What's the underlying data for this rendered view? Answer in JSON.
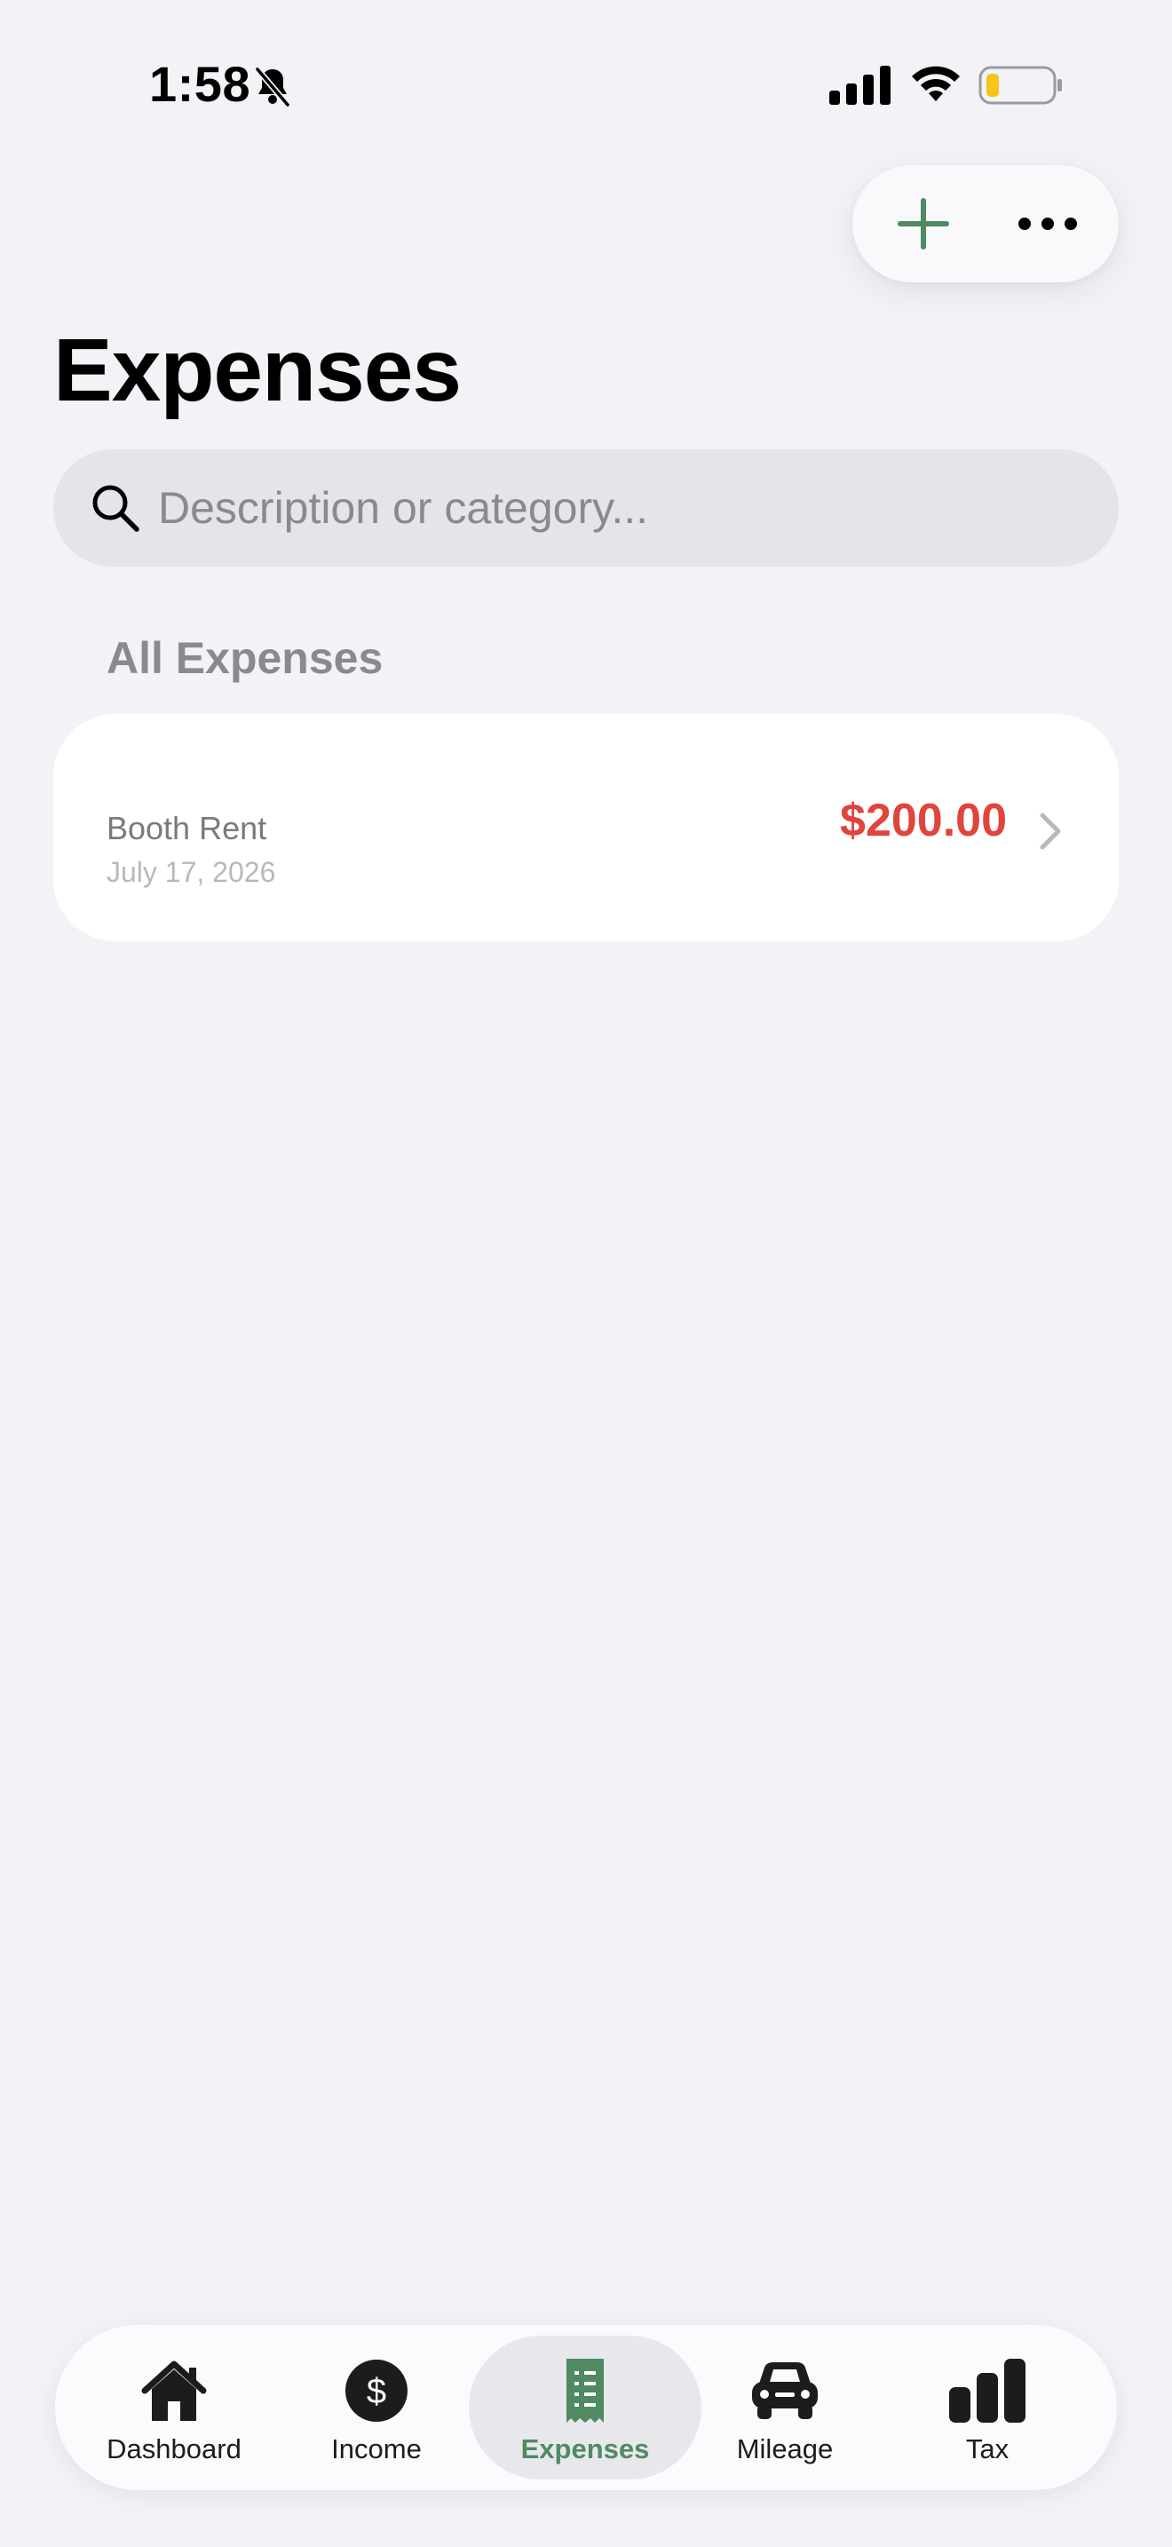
{
  "status_bar": {
    "time": "1:58"
  },
  "header": {
    "title": "Expenses"
  },
  "search": {
    "placeholder": "Description or category..."
  },
  "section": {
    "title": "All Expenses"
  },
  "expenses": [
    {
      "title": "Booth Rent",
      "date": "July 17, 2026",
      "amount": "$200.00"
    }
  ],
  "tabs": [
    {
      "label": "Dashboard",
      "icon": "house-icon"
    },
    {
      "label": "Income",
      "icon": "dollar-circle-icon"
    },
    {
      "label": "Expenses",
      "icon": "receipt-icon",
      "active": true
    },
    {
      "label": "Mileage",
      "icon": "car-icon"
    },
    {
      "label": "Tax",
      "icon": "bar-chart-icon"
    }
  ],
  "colors": {
    "accent": "#4f8a63",
    "expense_amount": "#e0443c",
    "background": "#f2f2f7",
    "battery_low": "#f5c518"
  }
}
